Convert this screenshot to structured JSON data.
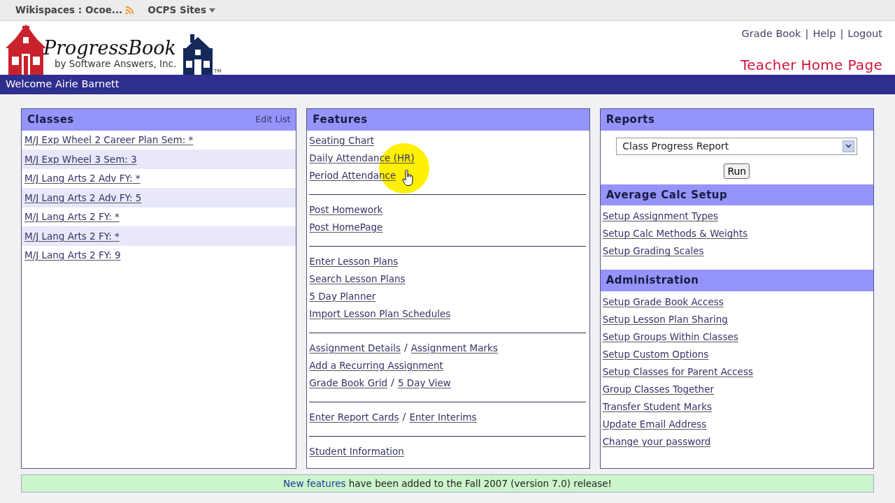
{
  "browser_toolbar": {
    "items": [
      {
        "label": "Wikispaces : Ocoe...",
        "kind": "feed"
      },
      {
        "label": "OCPS Sites",
        "kind": "menu"
      }
    ]
  },
  "header": {
    "logo": {
      "name": "ProgressBook",
      "byline": "by Software Answers, Inc.",
      "tm": "TM"
    },
    "links": [
      "Grade Book",
      "Help",
      "Logout"
    ],
    "separator": "|",
    "page_title": "Teacher Home Page"
  },
  "welcome": "Welcome Airie Barnett",
  "classes": {
    "title": "Classes",
    "edit_link": "Edit List",
    "items": [
      "M/J Exp Wheel 2 Career Plan Sem: *",
      "M/J Exp Wheel 3 Sem: 3",
      "M/J Lang Arts 2 Adv FY: *",
      "M/J Lang Arts 2 Adv FY: 5",
      "M/J Lang Arts 2 FY: *",
      "M/J Lang Arts 2 FY: *",
      "M/J Lang Arts 2 FY: 9"
    ]
  },
  "features": {
    "title": "Features",
    "separator": "/",
    "groups": [
      [
        [
          "Seating Chart"
        ],
        [
          "Daily Attendance (HR)"
        ],
        [
          "Period Attendance"
        ]
      ],
      [
        [
          "Post Homework"
        ],
        [
          "Post HomePage"
        ]
      ],
      [
        [
          "Enter Lesson Plans"
        ],
        [
          "Search Lesson Plans"
        ],
        [
          "5 Day Planner"
        ],
        [
          "Import Lesson Plan Schedules"
        ]
      ],
      [
        [
          "Assignment Details",
          "Assignment Marks"
        ],
        [
          "Add a Recurring Assignment"
        ],
        [
          "Grade Book Grid",
          "5 Day View"
        ]
      ],
      [
        [
          "Enter Report Cards",
          "Enter Interims"
        ]
      ],
      [
        [
          "Student Information"
        ]
      ]
    ]
  },
  "reports": {
    "title": "Reports",
    "select_value": "Class Progress Report",
    "run_button": "Run"
  },
  "average_calc": {
    "title": "Average Calc Setup",
    "links": [
      "Setup Assignment Types",
      "Setup Calc Methods & Weights",
      "Setup Grading Scales"
    ]
  },
  "administration": {
    "title": "Administration",
    "links": [
      "Setup Grade Book Access",
      "Setup Lesson Plan Sharing",
      "Setup Groups Within Classes",
      "Setup Custom Options",
      "Setup Classes for Parent Access",
      "Group Classes Together",
      "Transfer Student Marks",
      "Update Email Address",
      "Change your password"
    ]
  },
  "banner": {
    "link": "New features",
    "text": " have been added to the Fall 2007 (version 7.0) release!"
  }
}
